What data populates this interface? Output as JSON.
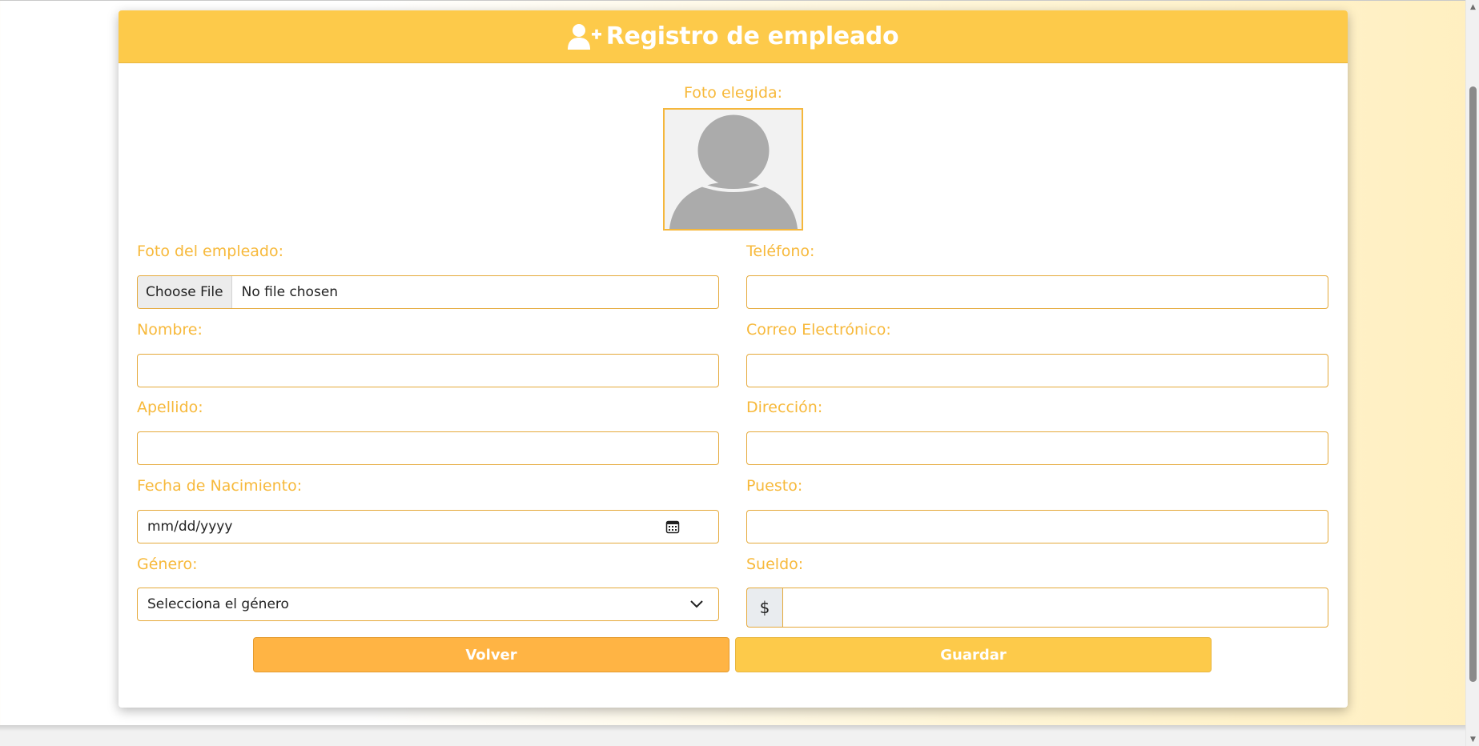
{
  "header": {
    "title": "Registro de empleado",
    "icon": "user-plus-icon"
  },
  "photo": {
    "label": "Foto elegida:",
    "placeholder_icon": "user-avatar-placeholder"
  },
  "form": {
    "foto_label": "Foto del empleado:",
    "file_button": "Choose File",
    "file_status": "No file chosen",
    "nombre_label": "Nombre:",
    "apellido_label": "Apellido:",
    "fecha_label": "Fecha de Nacimiento:",
    "fecha_placeholder": "mm/dd/yyyy",
    "genero_label": "Género:",
    "genero_selected": "Selecciona el género",
    "telefono_label": "Teléfono:",
    "correo_label": "Correo Electrónico:",
    "direccion_label": "Dirección:",
    "puesto_label": "Puesto:",
    "sueldo_label": "Sueldo:",
    "sueldo_prefix": "$"
  },
  "buttons": {
    "back": "Volver",
    "save": "Guardar"
  },
  "colors": {
    "accent": "#fdca4a",
    "label": "#f7b93b",
    "back_button": "#ffb444",
    "border": "#e5a93a"
  }
}
